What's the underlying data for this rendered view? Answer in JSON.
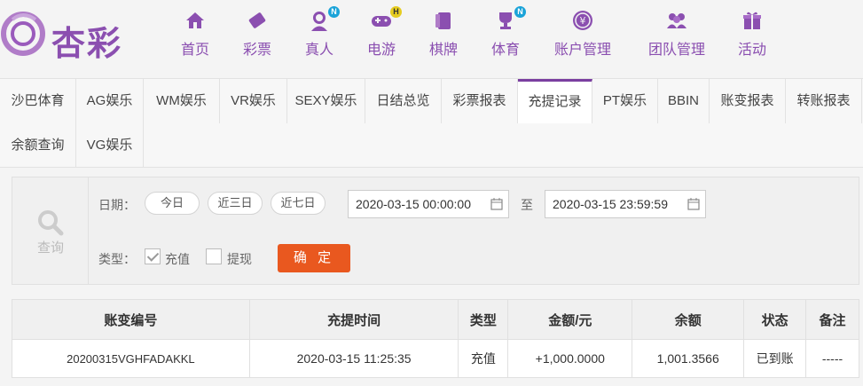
{
  "brand": {
    "logo_text": "杏彩"
  },
  "nav": [
    {
      "label": "首页",
      "icon": "home-icon"
    },
    {
      "label": "彩票",
      "icon": "ticket-icon"
    },
    {
      "label": "真人",
      "icon": "live-dealer-icon",
      "badge": "N"
    },
    {
      "label": "电游",
      "icon": "gamepad-icon",
      "badge": "H"
    },
    {
      "label": "棋牌",
      "icon": "cards-icon"
    },
    {
      "label": "体育",
      "icon": "trophy-icon",
      "badge": "N"
    },
    {
      "label": "账户管理",
      "icon": "yen-coin-icon"
    },
    {
      "label": "团队管理",
      "icon": "team-icon"
    },
    {
      "label": "活动",
      "icon": "gift-icon"
    }
  ],
  "tabs": [
    "沙巴体育",
    "AG娱乐",
    "WM娱乐",
    "VR娱乐",
    "SEXY娱乐",
    "日结总览",
    "彩票报表",
    "充提记录",
    "PT娱乐",
    "BBIN",
    "账变报表",
    "转账报表",
    "余额查询",
    "VG娱乐"
  ],
  "active_tab": "充提记录",
  "query": {
    "side_label": "查询",
    "date_label": "日期：",
    "quick": [
      "今日",
      "近三日",
      "近七日"
    ],
    "start": "2020-03-15 00:00:00",
    "to": "至",
    "end": "2020-03-15 23:59:59",
    "type_label": "类型：",
    "type_options": [
      {
        "label": "充值",
        "checked": true
      },
      {
        "label": "提现",
        "checked": false
      }
    ],
    "confirm": "确 定"
  },
  "table": {
    "headers": [
      "账变编号",
      "充提时间",
      "类型",
      "金额/元",
      "余额",
      "状态",
      "备注"
    ],
    "rows": [
      [
        "20200315VGHFADAKKL",
        "2020-03-15 11:25:35",
        "充值",
        "+1,000.0000",
        "1,001.3566",
        "已到账",
        "-----"
      ]
    ]
  },
  "colors": {
    "brand": "#7a3fa0",
    "confirm": "#e9581f",
    "amount": "#d9241d",
    "status": "#2fa12f"
  }
}
